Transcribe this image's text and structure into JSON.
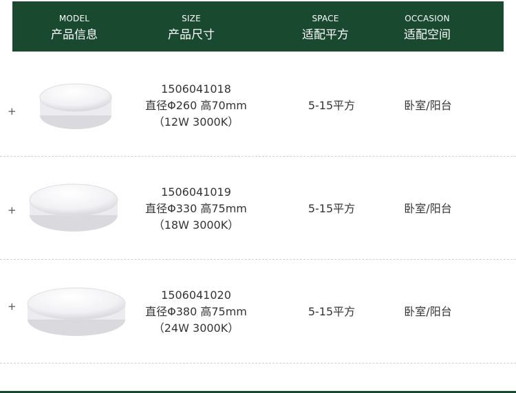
{
  "header": {
    "columns": [
      {
        "en": "MODEL",
        "zh": "产品信息"
      },
      {
        "en": "SIZE",
        "zh": "产品尺寸"
      },
      {
        "en": "SPACE",
        "zh": "适配平方"
      },
      {
        "en": "OCCASION",
        "zh": "适配空间"
      }
    ]
  },
  "rows": [
    {
      "plus": "+",
      "model": "1506041018",
      "size": "直径Φ260 高70mm",
      "spec": "（12W 3000K）",
      "space": "5-15平方",
      "occasion": "卧室/阳台"
    },
    {
      "plus": "+",
      "model": "1506041019",
      "size": "直径Φ330  高75mm",
      "spec": "（18W 3000K）",
      "space": "5-15平方",
      "occasion": "卧室/阳台"
    },
    {
      "plus": "+",
      "model": "1506041020",
      "size": "直径Φ380  高75mm",
      "spec": "（24W 3000K）",
      "space": "5-15平方",
      "occasion": "卧室/阳台"
    }
  ],
  "colors": {
    "header_bg": "#194a30",
    "header_text": "#ffffff",
    "body_text": "#333333",
    "divider": "#cfcfcf"
  },
  "icons": {
    "expand": "plus-icon",
    "product": "ceiling-lamp-image"
  }
}
